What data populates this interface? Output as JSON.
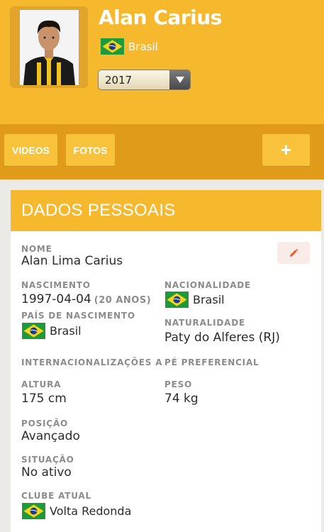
{
  "profile": {
    "name": "Alan Carius",
    "country": "Brasil",
    "season": "2017",
    "flag_colors": {
      "green": "#1f9a3b",
      "yellow": "#f7d51c",
      "blue": "#1d3d8c"
    }
  },
  "toolbar": {
    "videos_label": "VIDEOS",
    "fotos_label": "FOTOS",
    "add_label": "+"
  },
  "personal": {
    "section_title": "DADOS PESSOAIS",
    "nome_label": "NOME",
    "nome_value": "Alan Lima Carius",
    "nascimento_label": "NASCIMENTO",
    "nascimento_value": "1997-04-04",
    "age_value": "(20 ANOS)",
    "nacionalidade_label": "NACIONALIDADE",
    "nacionalidade_value": "Brasil",
    "pais_nascimento_label": "PAÍS DE NASCIMENTO",
    "pais_nascimento_value": "Brasil",
    "naturalidade_label": "NATURALIDADE",
    "naturalidade_value": "Paty do Alferes (RJ)",
    "internacionalizacoes_label": "INTERNACIONALIZAÇÕES A",
    "pe_label": "PÉ PREFERENCIAL",
    "altura_label": "ALTURA",
    "altura_value": "175 cm",
    "peso_label": "PESO",
    "peso_value": "74 kg",
    "posicao_label": "POSIÇÃO",
    "posicao_value": "Avançado",
    "situacao_label": "SITUAÇÃO",
    "situacao_value": "No ativo",
    "clube_label": "CLUBE ATUAL",
    "clube_value": "Volta Redonda"
  },
  "icons": {
    "edit": "pencil-icon",
    "dropdown": "triangle-down-icon"
  }
}
